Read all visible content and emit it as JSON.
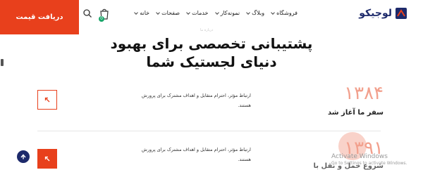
{
  "header": {
    "quote_button": "دریافت قیمت",
    "cart_count": "0",
    "nav": [
      {
        "label": "خانه"
      },
      {
        "label": "صفحات"
      },
      {
        "label": "خدمات"
      },
      {
        "label": "نمونه‌کار"
      },
      {
        "label": "وبلاگ"
      },
      {
        "label": "فروشگاه"
      }
    ],
    "logo_text": "لوجیکو"
  },
  "hero": {
    "eyebrow": "درباره ما",
    "title_line1": "پشتیبانی تخصصی برای بهبود",
    "title_line2": "دنیای لجستیک شما"
  },
  "rows": [
    {
      "year": "۱۳۸۴",
      "label": "سفر ما آغاز شد",
      "desc": "ارتباط مؤثر، احترام متقابل و اهداف مشترک برای پرورش هستند."
    },
    {
      "year": "۱۳۹۱",
      "label": "شروع حمل و نقل با",
      "desc": "ارتباط مؤثر، احترام متقابل و اهداف مشترک برای پرورش هستند."
    }
  ],
  "watermark": {
    "line1": "Activate Windows",
    "line2": "Go to Settings to activate Windows."
  },
  "colors": {
    "accent": "#e8401c",
    "brand": "#1d2a6b",
    "year": "#f2a08d"
  }
}
